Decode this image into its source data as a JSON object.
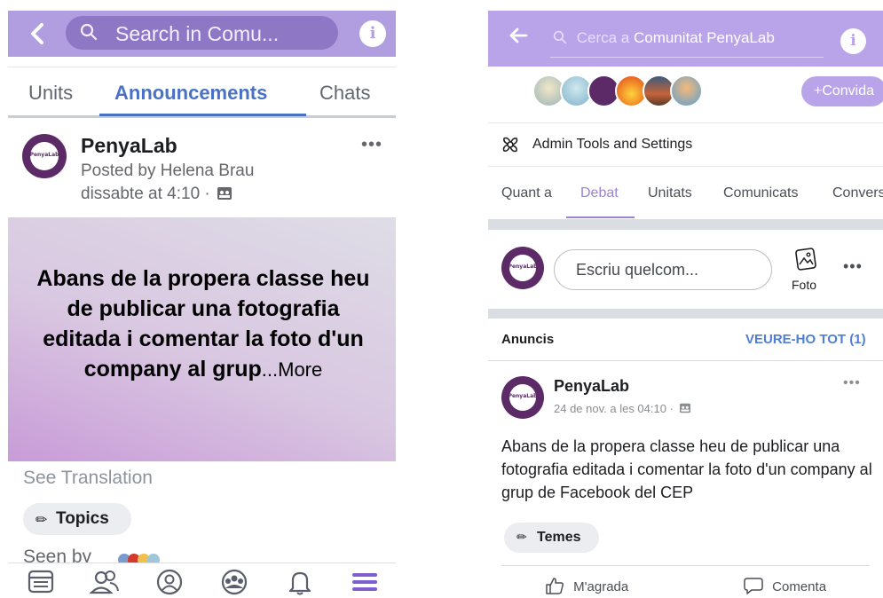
{
  "left": {
    "header": {
      "back_icon": "chevron-left-icon",
      "search_placeholder": "Search in Comu...",
      "info_icon": "info-icon"
    },
    "tabs": [
      "Units",
      "Announcements",
      "Chats"
    ],
    "active_tab": "Announcements",
    "post": {
      "group_name": "PenyaLab",
      "avatar_text": "PenyaLab",
      "posted_by": "Posted by Helena Brau",
      "time": "dissabte at 4:10 ·",
      "banner_text": "Abans de la propera classe heu de publicar una fotografia editada i comentar la foto d'un company al grup",
      "more": "...More",
      "see_translation": "See Translation",
      "topics": "Topics",
      "seen_by": "Seen by"
    },
    "bottom_nav": [
      "news-feed-icon",
      "friends-icon",
      "profile-icon",
      "groups-icon",
      "notifications-icon",
      "menu-icon"
    ]
  },
  "right": {
    "header": {
      "back_icon": "arrow-left-icon",
      "search_prefix": "Cerca a",
      "search_group": "Comunitat PenyaLab",
      "info_icon": "info-icon"
    },
    "invite": "+Convida",
    "admin_tools": "Admin Tools and Settings",
    "tabs": [
      "Quant a",
      "Debat",
      "Unitats",
      "Comunicats",
      "Convers"
    ],
    "active_tab": "Debat",
    "composer": {
      "placeholder": "Escriu quelcom...",
      "photo_label": "Foto"
    },
    "announcements": {
      "title": "Anuncis",
      "see_all": "VEURE-HO TOT (1)"
    },
    "post": {
      "group_name": "PenyaLab",
      "avatar_text": "PenyaLab",
      "time": "24 de nov. a les 04:10 ·",
      "body": "Abans de la propera classe heu de publicar una fotografia editada i comentar la foto d'un company al grup de Facebook del CEP",
      "topics": "Temes",
      "like": "M'agrada",
      "comment": "Comenta"
    }
  },
  "colors": {
    "left_header": "#b09ee0",
    "right_header": "#b9a4ea",
    "accent_blue": "#4a72c4",
    "tab_purple": "#9a82d6",
    "avatar": "#5b2a67"
  }
}
